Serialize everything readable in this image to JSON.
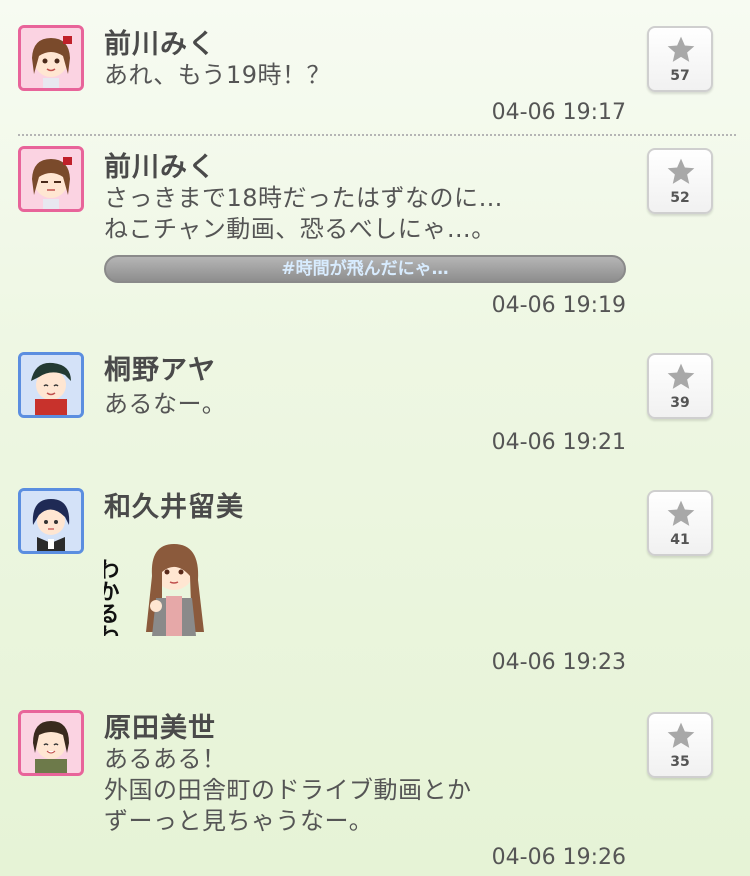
{
  "posts": [
    {
      "name": "前川みく",
      "message": "あれ、もう19時！？",
      "time": "04-06 19:17",
      "likes": "57"
    },
    {
      "name": "前川みく",
      "message": "さっきまで18時だったはずなのに…\nねこチャン動画、恐るべしにゃ…。",
      "hashtag": "#時間が飛んだにゃ…",
      "time": "04-06 19:19",
      "likes": "52"
    },
    {
      "name": "桐野アヤ",
      "message": "あるなー。",
      "time": "04-06 19:21",
      "likes": "39"
    },
    {
      "name": "和久井留美",
      "stamp_text": "わかるわ。",
      "time": "04-06 19:23",
      "likes": "41"
    },
    {
      "name": "原田美世",
      "message": "あるある！\n外国の田舎町のドライブ動画とか\nずーっと見ちゃうなー。",
      "time": "04-06 19:26",
      "likes": "35"
    }
  ],
  "colors": {
    "frame_pink": "#e8649a",
    "frame_blue": "#5b8ee0",
    "hashtag_text": "#d8ecff"
  },
  "icons": {
    "like": "star-icon",
    "avatar": "character-portrait"
  }
}
